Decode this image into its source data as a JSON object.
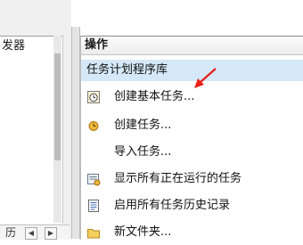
{
  "left_panel": {
    "row_text": "发器",
    "scroll_label": "历"
  },
  "actions_pane": {
    "title": "操作",
    "section_title": "任务计划程序库",
    "items": [
      {
        "label": "创建基本任务...",
        "icon": "create-basic-task-icon"
      },
      {
        "label": "创建任务...",
        "icon": "create-task-icon"
      },
      {
        "label": "导入任务...",
        "icon": ""
      },
      {
        "label": "显示所有正在运行的任务",
        "icon": "running-tasks-icon"
      },
      {
        "label": "启用所有任务历史记录",
        "icon": "task-history-icon"
      },
      {
        "label": "新文件夹...",
        "icon": "folder-icon"
      }
    ]
  },
  "annotation": {
    "arrow_color": "#e8201c"
  },
  "colors": {
    "section_bg": "#d5e8f7"
  }
}
